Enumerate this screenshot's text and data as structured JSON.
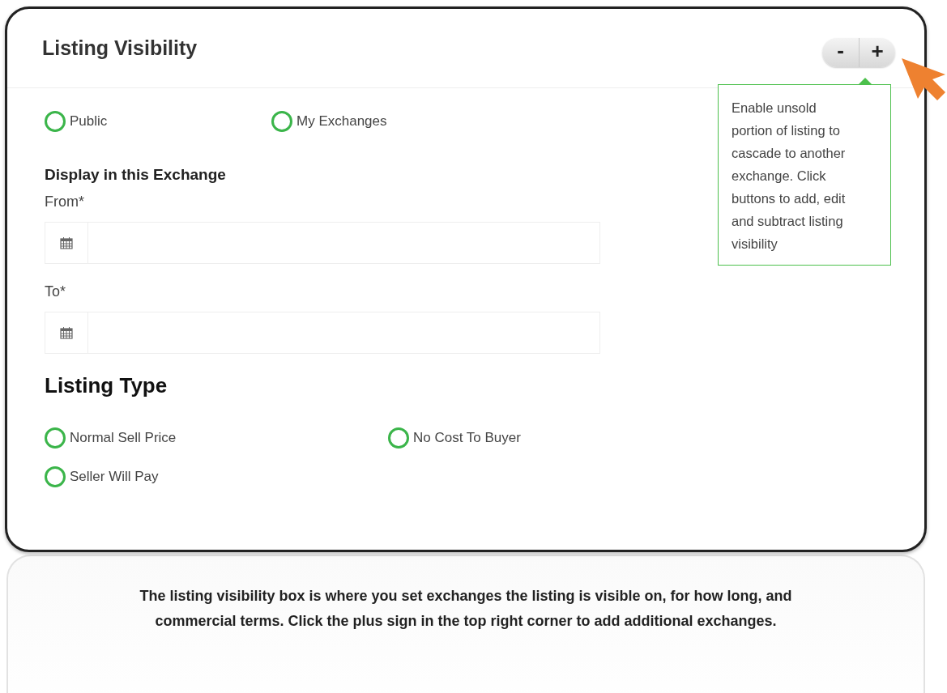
{
  "panel": {
    "title": "Listing Visibility",
    "buttons": [
      {
        "label": "-",
        "kind": "minus"
      },
      {
        "label": "+",
        "kind": "plus"
      }
    ],
    "tooltip": "Enable unsold portion of listing to cascade to another exchange. Click buttons to add, edit and subtract listing visibility",
    "visibility_options": [
      {
        "label": "Public",
        "selected": false
      },
      {
        "label": "My Exchanges",
        "selected": false
      }
    ],
    "exchange_heading": "Display in this Exchange",
    "date_fields": [
      {
        "label": "From*"
      },
      {
        "label": "To*"
      }
    ],
    "listing_type_heading": "Listing Type",
    "listing_type_options": [
      {
        "label": "Normal Sell Price",
        "selected": false
      },
      {
        "label": "No Cost To Buyer",
        "selected": false
      },
      {
        "label": "Seller Will Pay",
        "selected": false
      }
    ]
  },
  "caption": "The listing visibility box is where you set exchanges the listing is visible on, for how long, and commercial terms. Click the plus sign in the top right corner to add additional exchanges."
}
